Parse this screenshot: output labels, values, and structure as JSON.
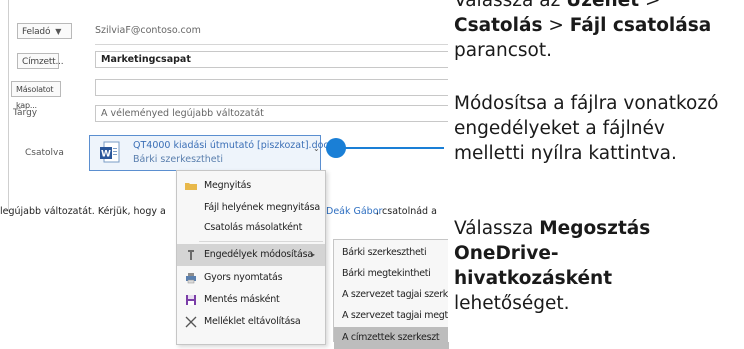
{
  "email": {
    "from_button": "Feladó",
    "from_value": "SzilviaF@contoso.com",
    "to_button": "Címzett...",
    "to_value": "Marketingcsapat",
    "cc_button": "Másolatot kap...",
    "subject_label": "Tárgy",
    "subject_value": "A véleményed legújabb változatát",
    "attached_label": "Csatolva",
    "attachment_name": "QT4000 kiadási útmutató [piszkozat].docx",
    "attachment_caret": "⌄",
    "attachment_sub": "Bárki szerkesztheti",
    "body_left": "legújabb változatát. Kérjük, hogy a",
    "body_link": "Deák Gábor",
    "body_right": ", csatolnád a"
  },
  "context_menu": {
    "items": [
      {
        "label": "Megnyitás",
        "icon": "folder-icon"
      },
      {
        "label": "Fájl helyének megnyitása",
        "icon": ""
      },
      {
        "label": "Csatolás másolatként",
        "icon": ""
      },
      {
        "label": "Engedélyek módosítása",
        "icon": "permissions-icon",
        "highlighted": true
      },
      {
        "label": "Gyors nyomtatás",
        "icon": "printer-icon"
      },
      {
        "label": "Mentés másként",
        "icon": "save-icon"
      },
      {
        "label": "Melléklet eltávolítása",
        "icon": "close-icon"
      }
    ]
  },
  "submenu": {
    "items": [
      {
        "label": "Bárki szerkesztheti"
      },
      {
        "label": "Bárki megtekintheti"
      },
      {
        "label": "A szervezet tagjai szerkesz"
      },
      {
        "label": "A szervezet tagjai megtek"
      },
      {
        "label": "A címzettek szerkeszt",
        "highlighted": true
      }
    ]
  },
  "instructions": {
    "p1_pre": "Válassza az ",
    "p1_b1": "Üzenet",
    "p1_mid1": " > ",
    "p1_b2": "Csatolás",
    "p1_mid2": " > ",
    "p1_b3": "Fájl csatolása",
    "p1_post": " parancsot.",
    "p2": "Módosítsa a fájlra vonatkozó engedélyeket a fájlnév melletti nyílra kattintva.",
    "p3_pre": "Válassza ",
    "p3_b": "Megosztás OneDrive-hivatkozásként",
    "p3_post": " lehetőséget."
  },
  "colors": {
    "accent": "#1a7fd6",
    "link": "#2e6fc1"
  }
}
